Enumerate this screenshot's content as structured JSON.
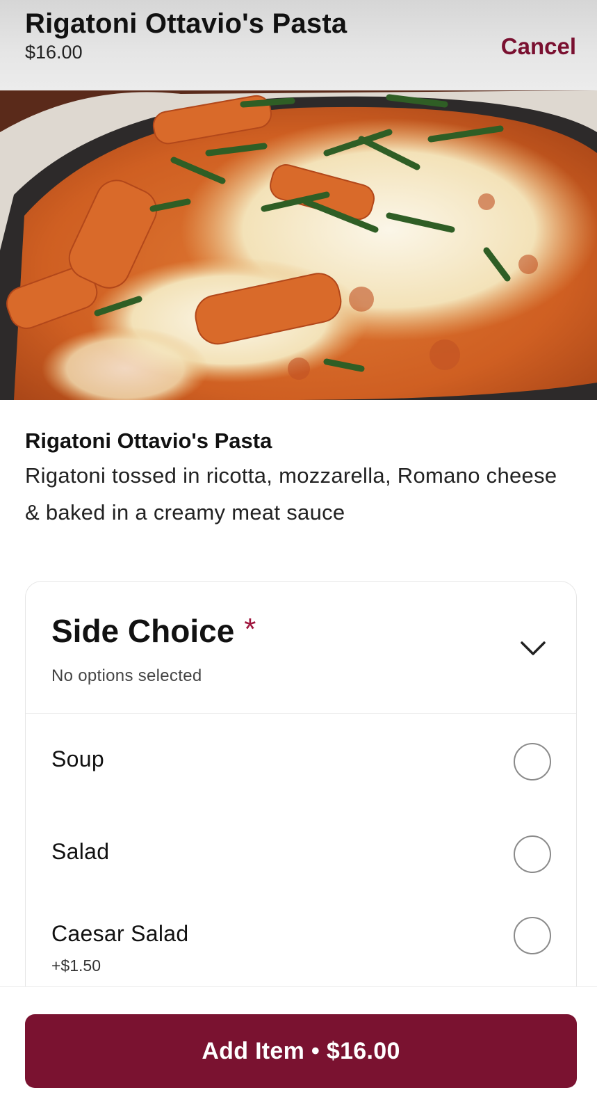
{
  "header": {
    "title": "Rigatoni Ottavio's Pasta",
    "price": "$16.00",
    "cancel_label": "Cancel"
  },
  "hero_image": {
    "subject": "baked rigatoni with melted cheese, tomato cream sauce and basil"
  },
  "item": {
    "name": "Rigatoni Ottavio's Pasta",
    "description": "Rigatoni tossed in ricotta, mozzarella, Romano cheese & baked in a creamy meat sauce"
  },
  "side_choice": {
    "title": "Side Choice",
    "required_mark": "*",
    "status": "No options selected",
    "icon": "chevron-down-icon",
    "options": [
      {
        "label": "Soup",
        "price": "",
        "selected": false
      },
      {
        "label": "Salad",
        "price": "",
        "selected": false
      },
      {
        "label": "Caesar Salad",
        "price": "+$1.50",
        "selected": false
      }
    ]
  },
  "footer": {
    "add_button_label": "Add Item • $16.00"
  },
  "colors": {
    "brand": "#7a1230",
    "required": "#a0163e",
    "radio_border": "#8a8a8a"
  }
}
